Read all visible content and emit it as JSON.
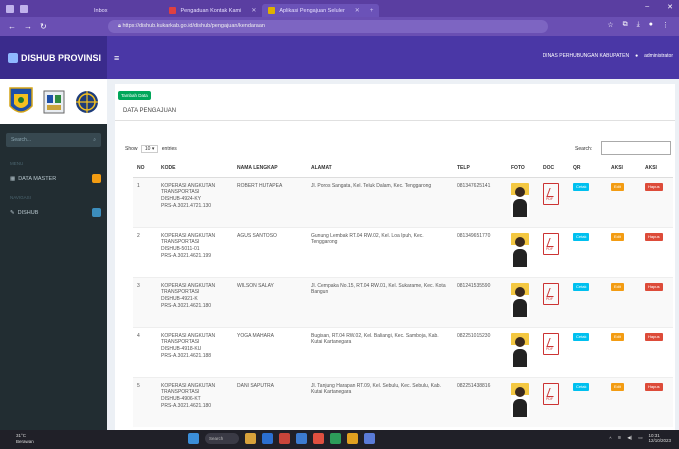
{
  "browser": {
    "tabs": [
      {
        "title": "Inbox",
        "color": "#7a8fbf"
      },
      {
        "title": "Pengaduan Kontak Kami",
        "color": "#e04040"
      },
      {
        "title": "Aplikasi Pengajuan Seluler",
        "color": "#e0b000"
      }
    ],
    "url": "https://dishub.kukarkab.go.id/dishub/pengajuan/kendaraan"
  },
  "app": {
    "brand": "DISHUB PROVINSI",
    "user": "DINAS PERHUBUNGAN KABUPATEN",
    "user_name": "administrator"
  },
  "sidebar": {
    "search_placeholder": "Search...",
    "section_main": "MENU",
    "item_data": "DATA MASTER",
    "section_other": "NAVIGASI",
    "item_dishub": "DISHUB"
  },
  "content": {
    "add_button": "Tambah Data",
    "panel_title": "DATA PENGAJUAN",
    "show_label": "Show",
    "show_value": "10",
    "entries_label": "entries",
    "search_label": "Search:",
    "columns": [
      "NO",
      "KODE",
      "NAMA LENGKAP",
      "ALAMAT",
      "TELP",
      "FOTO",
      "DOC",
      "QR",
      "AKSI",
      "AKSI"
    ],
    "rows": [
      {
        "no": "1",
        "kode": [
          "KOPERASI ANGKUTAN",
          "TRANSPORTASI",
          "DISHUB-4924-KY",
          "PRS-A.3021.4721.130"
        ],
        "nama": "ROBERT HUTAPEA",
        "alamat": "Jl. Poros Sangata, Kel. Teluk Dalam, Kec. Tenggarong",
        "telp": "081347625141"
      },
      {
        "no": "2",
        "kode": [
          "KOPERASI ANGKUTAN",
          "TRANSPORTASI",
          "DISHUB-5011-01",
          "PRS-A.3021.4621.199"
        ],
        "nama": "AGUS SANTOSO",
        "alamat": "Gunung Lembak RT.04 RW.02, Kel. Loa Ipuh, Kec. Tenggarong",
        "telp": "081349651770"
      },
      {
        "no": "3",
        "kode": [
          "KOPERASI ANGKUTAN",
          "TRANSPORTASI",
          "DISHUB-4921-K",
          "PRS-A.3021.4621.180"
        ],
        "nama": "WILSON SALAY",
        "alamat": "Jl. Cempaka No.15, RT.04 RW.01, Kel. Sukarame, Kec. Kota Bangun",
        "telp": "081241535590"
      },
      {
        "no": "4",
        "kode": [
          "KOPERASI ANGKUTAN",
          "TRANSPORTASI",
          "DISHUB-4918-KU",
          "PRS-A.3021.4621.188"
        ],
        "nama": "YOGA MAHARA",
        "alamat": "Bugisan, RT.04 RW.02, Kel. Baliangi, Kec. Samboja, Kab. Kutai Kartanegara",
        "telp": "082251015230"
      },
      {
        "no": "5",
        "kode": [
          "KOPERASI ANGKUTAN",
          "TRANSPORTASI",
          "DISHUB-4906-KT",
          "PRS-A.3021.4621.180"
        ],
        "nama": "DANI SAPUTRA",
        "alamat": "Jl. Tanjung Harapan RT.09, Kel. Sebulu, Kec. Sebulu, Kab. Kutai Kartanegara",
        "telp": "082251438816"
      }
    ],
    "qr_label": "Cetak",
    "edit_label": "Edit",
    "delete_label": "Hapus",
    "pdf_label": "PDF"
  },
  "taskbar": {
    "weather_temp": "31°C",
    "weather_desc": "Berawan",
    "search": "Search",
    "time": "10:31",
    "date": "12/10/2023"
  },
  "colors": {
    "header": "#4a37a6",
    "sidebar": "#222d32",
    "qr_button": "#00c0ef",
    "edit_button": "#f39c12",
    "delete_button": "#dd4b39"
  }
}
